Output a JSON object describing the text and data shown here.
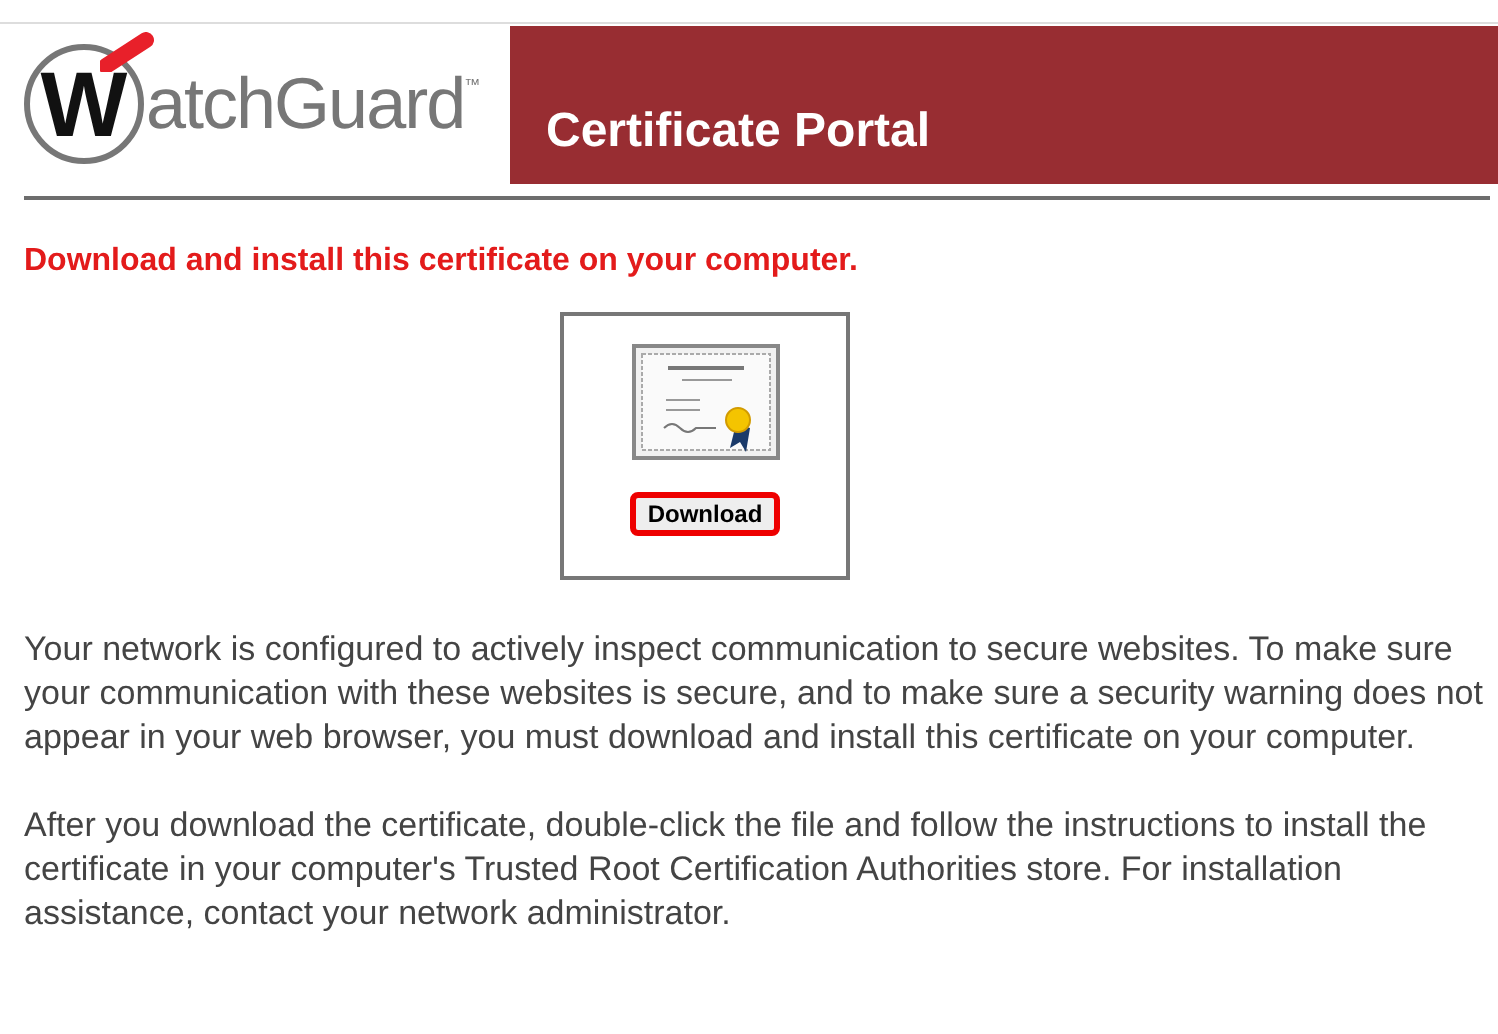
{
  "logo": {
    "mark": "W",
    "text": "atchGuard",
    "trademark": "™"
  },
  "header": {
    "title": "Certificate Portal"
  },
  "instruction": "Download and install this certificate on your computer.",
  "download": {
    "label": "Download",
    "highlighted": true
  },
  "paragraphs": [
    "Your network is configured to actively inspect communication to secure websites. To make sure your communication with these websites is secure, and to make sure a security warning does not appear in your web browser, you must download and install this certificate on your computer.",
    "After you download the certificate, double-click the file and follow the instructions to install the certificate in your computer's Trusted Root Certification Authorities store. For installation assistance, contact your network administrator."
  ]
}
